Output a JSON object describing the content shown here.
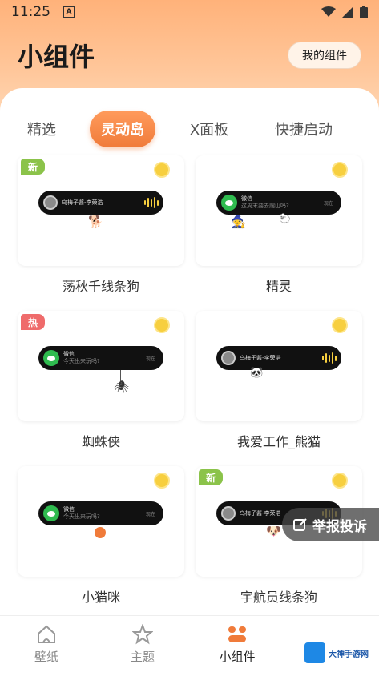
{
  "status_bar": {
    "time": "11:25",
    "indicator": "A"
  },
  "header": {
    "title": "小组件",
    "my_widgets_label": "我的组件"
  },
  "tabs": [
    {
      "label": "精选",
      "active": false
    },
    {
      "label": "灵动岛",
      "active": true
    },
    {
      "label": "X面板",
      "active": false
    },
    {
      "label": "快捷启动",
      "active": false
    }
  ],
  "cards": [
    {
      "name": "荡秋千线条狗",
      "badge": "新",
      "pill_title": "乌梅子酱-李荣浩",
      "pill_type": "music"
    },
    {
      "name": "精灵",
      "badge": "",
      "pill_title": "微信",
      "pill_sub": "这周末要去爬山吗?",
      "pill_meta": "现在",
      "pill_type": "wechat"
    },
    {
      "name": "蜘蛛侠",
      "badge": "热",
      "pill_title": "微信",
      "pill_sub": "今天出来玩吗?",
      "pill_meta": "现在",
      "pill_type": "wechat"
    },
    {
      "name": "我爱工作_熊猫",
      "badge": "",
      "pill_title": "乌梅子酱-李荣浩",
      "pill_type": "music"
    },
    {
      "name": "小猫咪",
      "badge": "",
      "pill_title": "微信",
      "pill_sub": "今天出来玩吗?",
      "pill_meta": "现在",
      "pill_type": "wechat"
    },
    {
      "name": "宇航员线条狗",
      "badge": "新",
      "pill_title": "乌梅子酱-李荣浩",
      "pill_type": "music"
    }
  ],
  "report_button": {
    "label": "举报投诉"
  },
  "bottom_nav": [
    {
      "label": "壁纸",
      "icon": "home-icon",
      "active": false
    },
    {
      "label": "主题",
      "icon": "star-icon",
      "active": false
    },
    {
      "label": "小组件",
      "icon": "widgets-icon",
      "active": true
    }
  ],
  "watermark": {
    "text": "大神手游网"
  },
  "colors": {
    "accent": "#f07b3a",
    "header": "#ffb27a",
    "new_badge": "#8bc34a",
    "hot_badge": "#ef6b6b",
    "wechat": "#2fbb4f"
  }
}
